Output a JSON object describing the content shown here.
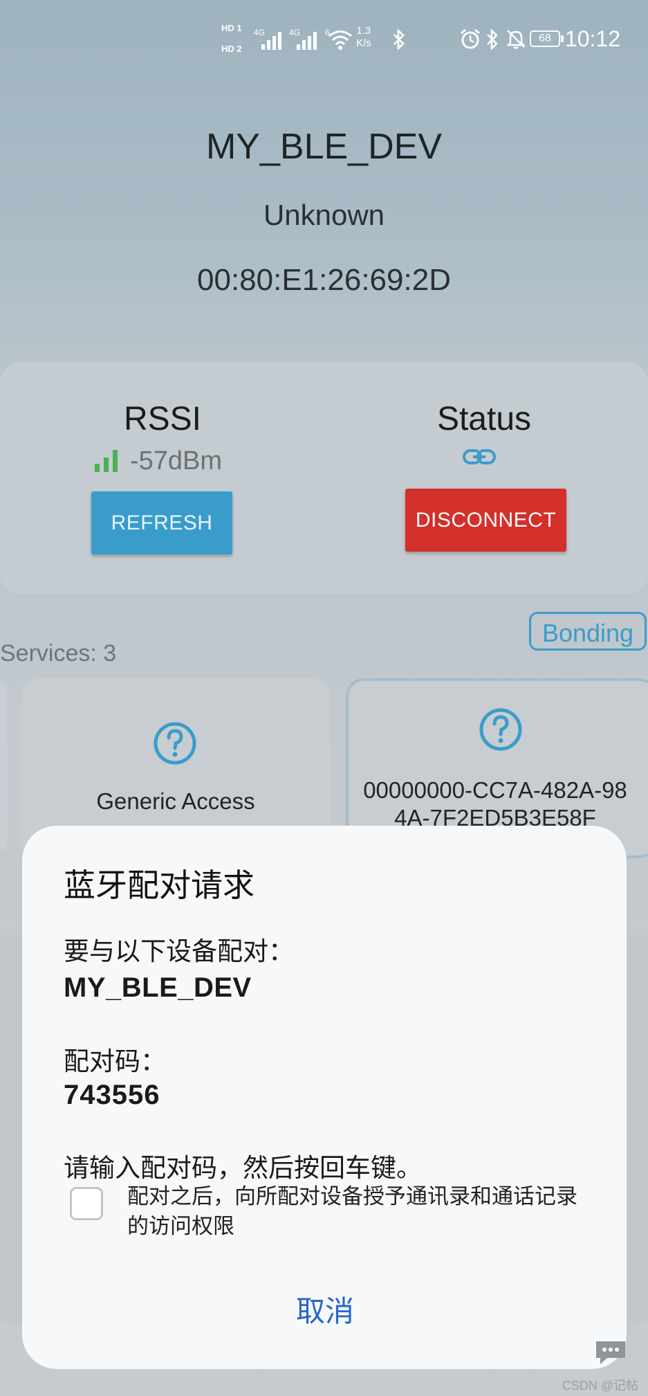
{
  "status_bar": {
    "sim1_label": "HD 1",
    "sim2_label": "HD 2",
    "net1": "4G",
    "net2": "4G",
    "wifi_gen": "6",
    "speed_value": "1.3",
    "speed_unit": "K/s",
    "battery": "68",
    "time": "10:12",
    "icons": [
      "signal-icon",
      "wifi-icon",
      "bluetooth-icon",
      "alarm-icon",
      "mute-icon",
      "battery-icon"
    ]
  },
  "device": {
    "name": "MY_BLE_DEV",
    "type": "Unknown",
    "address": "00:80:E1:26:69:2D"
  },
  "info_card": {
    "rssi_title": "RSSI",
    "rssi_value": "-57dBm",
    "status_title": "Status",
    "refresh_label": "REFRESH",
    "disconnect_label": "DISCONNECT",
    "accent_color": "#3a9ccb",
    "danger_color": "#d3302b",
    "signal_color": "#4caf50"
  },
  "bonding_label": "Bonding",
  "services_label": "Services: 3",
  "services": [
    {
      "label": "Generic Access",
      "icon": "question-icon"
    },
    {
      "label_line1": "00000000-CC7A-482A-98",
      "label_line2": "4A-7F2ED5B3E58F",
      "icon": "question-icon"
    }
  ],
  "dialog": {
    "title": "蓝牙配对请求",
    "pair_with_label": "要与以下设备配对：",
    "device_name": "MY_BLE_DEV",
    "code_label": "配对码：",
    "code": "743556",
    "instruction": "请输入配对码，然后按回车键。",
    "checkbox_text": "配对之后，向所配对设备授予通讯录和通话记录的访问权限",
    "checkbox_checked": false,
    "cancel_label": "取消"
  },
  "watermark": "CSDN @记帖"
}
